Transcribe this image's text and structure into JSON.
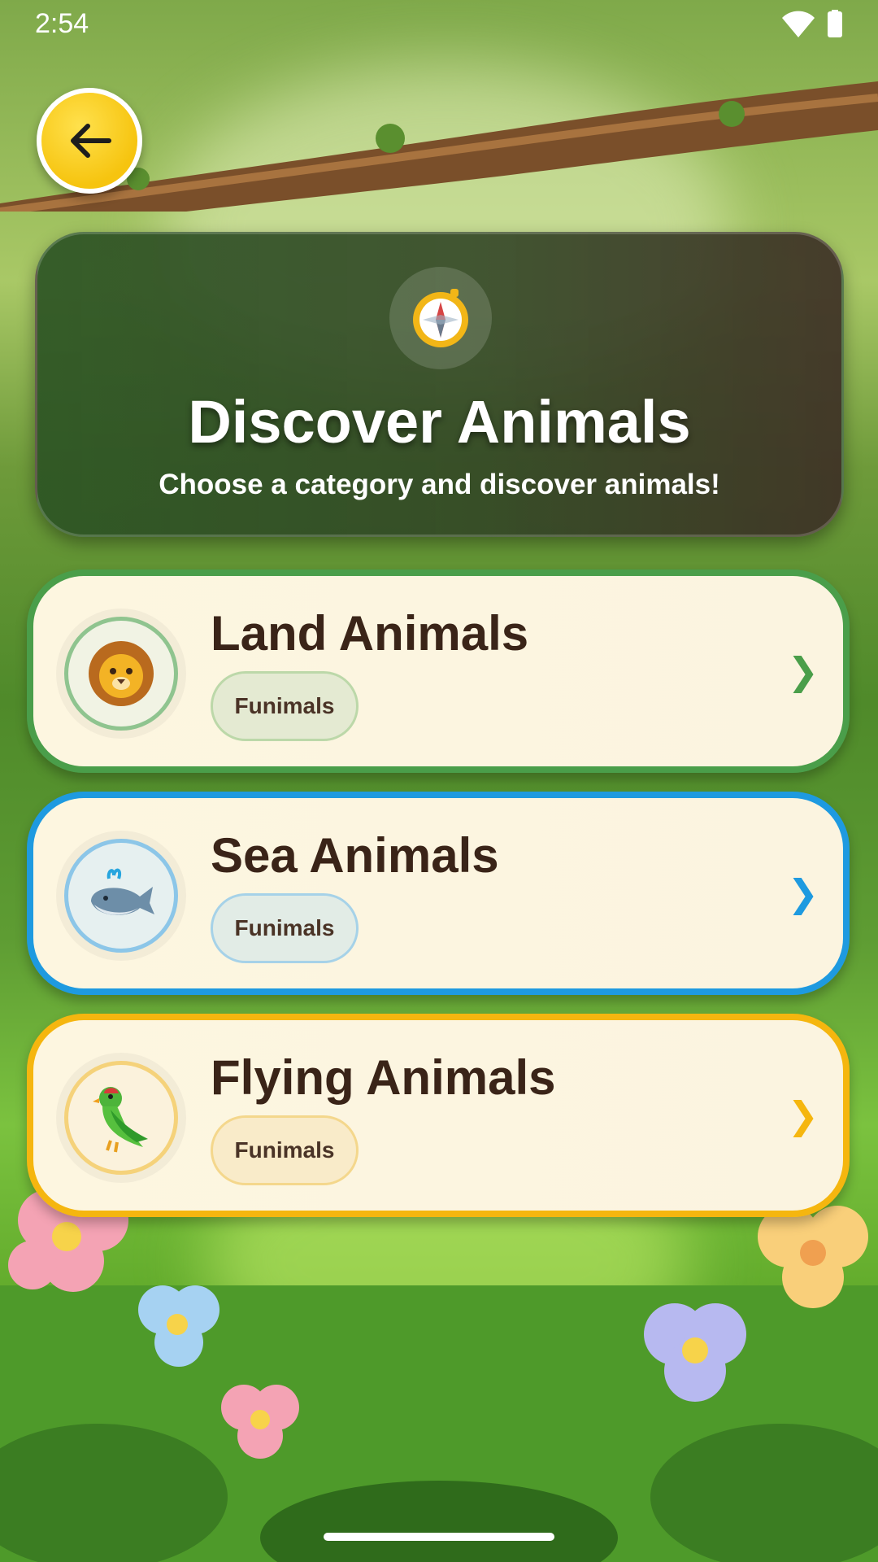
{
  "status_bar": {
    "time": "2:54"
  },
  "header": {
    "title": "Discover Animals",
    "subtitle": "Choose a category and discover animals!",
    "icon": "compass-icon"
  },
  "categories": [
    {
      "title": "Land Animals",
      "pill": "Funimals",
      "icon": "lion-icon",
      "accent": "#4a9e4a",
      "arrow": "❯"
    },
    {
      "title": "Sea Animals",
      "pill": "Funimals",
      "icon": "whale-icon",
      "accent": "#1e9ae0",
      "arrow": "❯"
    },
    {
      "title": "Flying Animals",
      "pill": "Funimals",
      "icon": "parrot-icon",
      "accent": "#f5b60f",
      "arrow": "❯"
    }
  ]
}
